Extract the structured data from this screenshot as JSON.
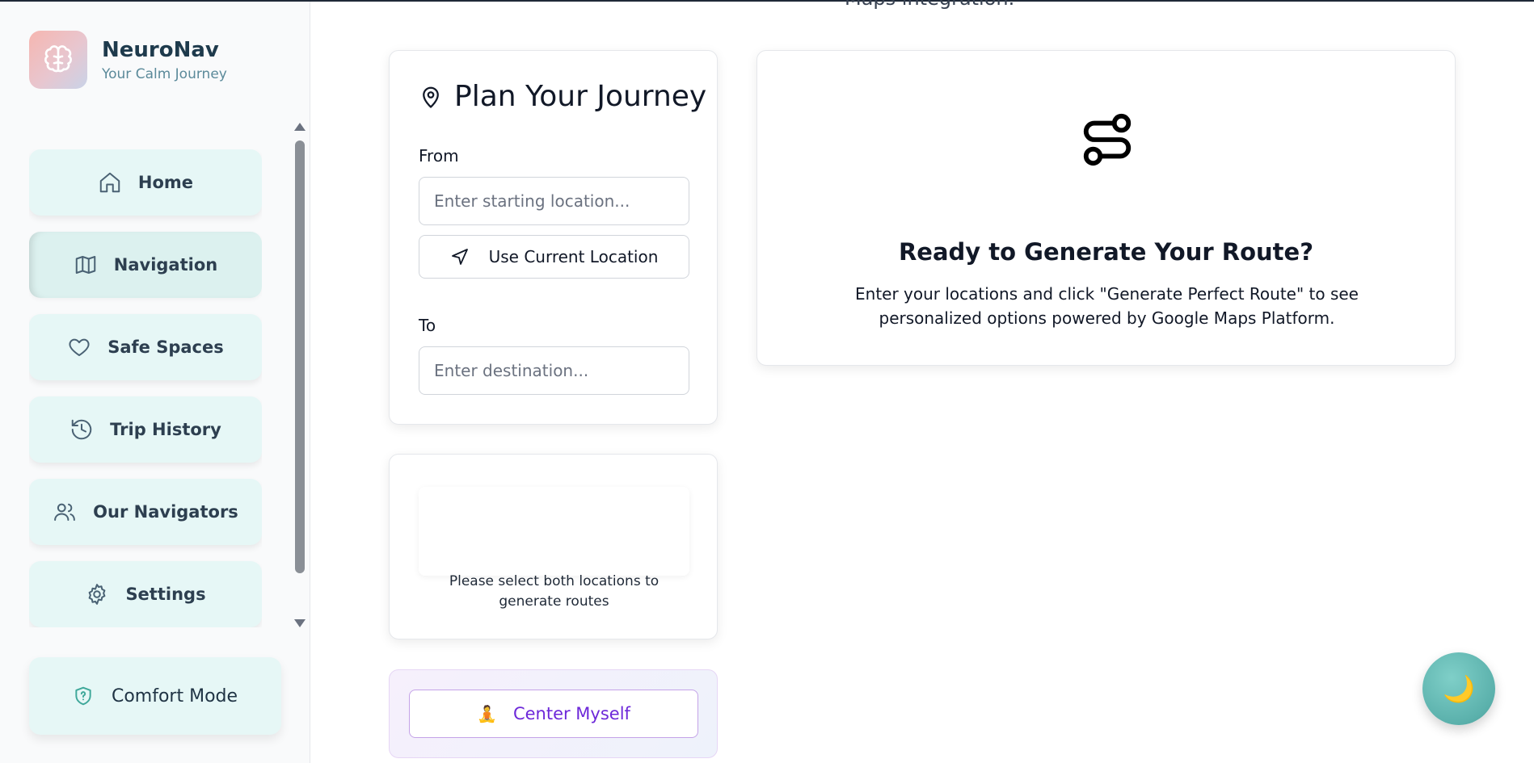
{
  "brand": {
    "name": "NeuroNav",
    "subtitle": "Your Calm Journey",
    "logo_icon": "brain-icon"
  },
  "header": {
    "cut_heading": "Maps integration."
  },
  "sidebar": {
    "items": [
      {
        "label": "Home",
        "icon": "home-icon"
      },
      {
        "label": "Navigation",
        "icon": "map-icon",
        "active": true
      },
      {
        "label": "Safe Spaces",
        "icon": "heart-icon"
      },
      {
        "label": "Trip History",
        "icon": "history-icon"
      },
      {
        "label": "Our Navigators",
        "icon": "users-icon"
      },
      {
        "label": "Settings",
        "icon": "gear-icon"
      }
    ],
    "comfort_label": "Comfort Mode",
    "comfort_icon": "shield-icon"
  },
  "plan": {
    "title": "Plan Your Journey",
    "from_label": "From",
    "from_placeholder": "Enter starting location...",
    "from_value": "",
    "use_current_label": "Use Current Location",
    "to_label": "To",
    "to_placeholder": "Enter destination...",
    "to_value": ""
  },
  "routes": {
    "message": "Please select both locations to generate routes"
  },
  "center": {
    "emoji": "🧘",
    "label": "Center Myself"
  },
  "ready": {
    "title": "Ready to Generate Your Route?",
    "description": "Enter your locations and click \"Generate Perfect Route\" to see personalized options powered by Google Maps Platform.",
    "icon": "route-icon"
  },
  "fab": {
    "icon": "moon-icon",
    "glyph": "🌙"
  },
  "colors": {
    "accent_teal": "#e6f7f6",
    "purple": "#6d28d9",
    "brand_text": "#1e3a4c"
  }
}
